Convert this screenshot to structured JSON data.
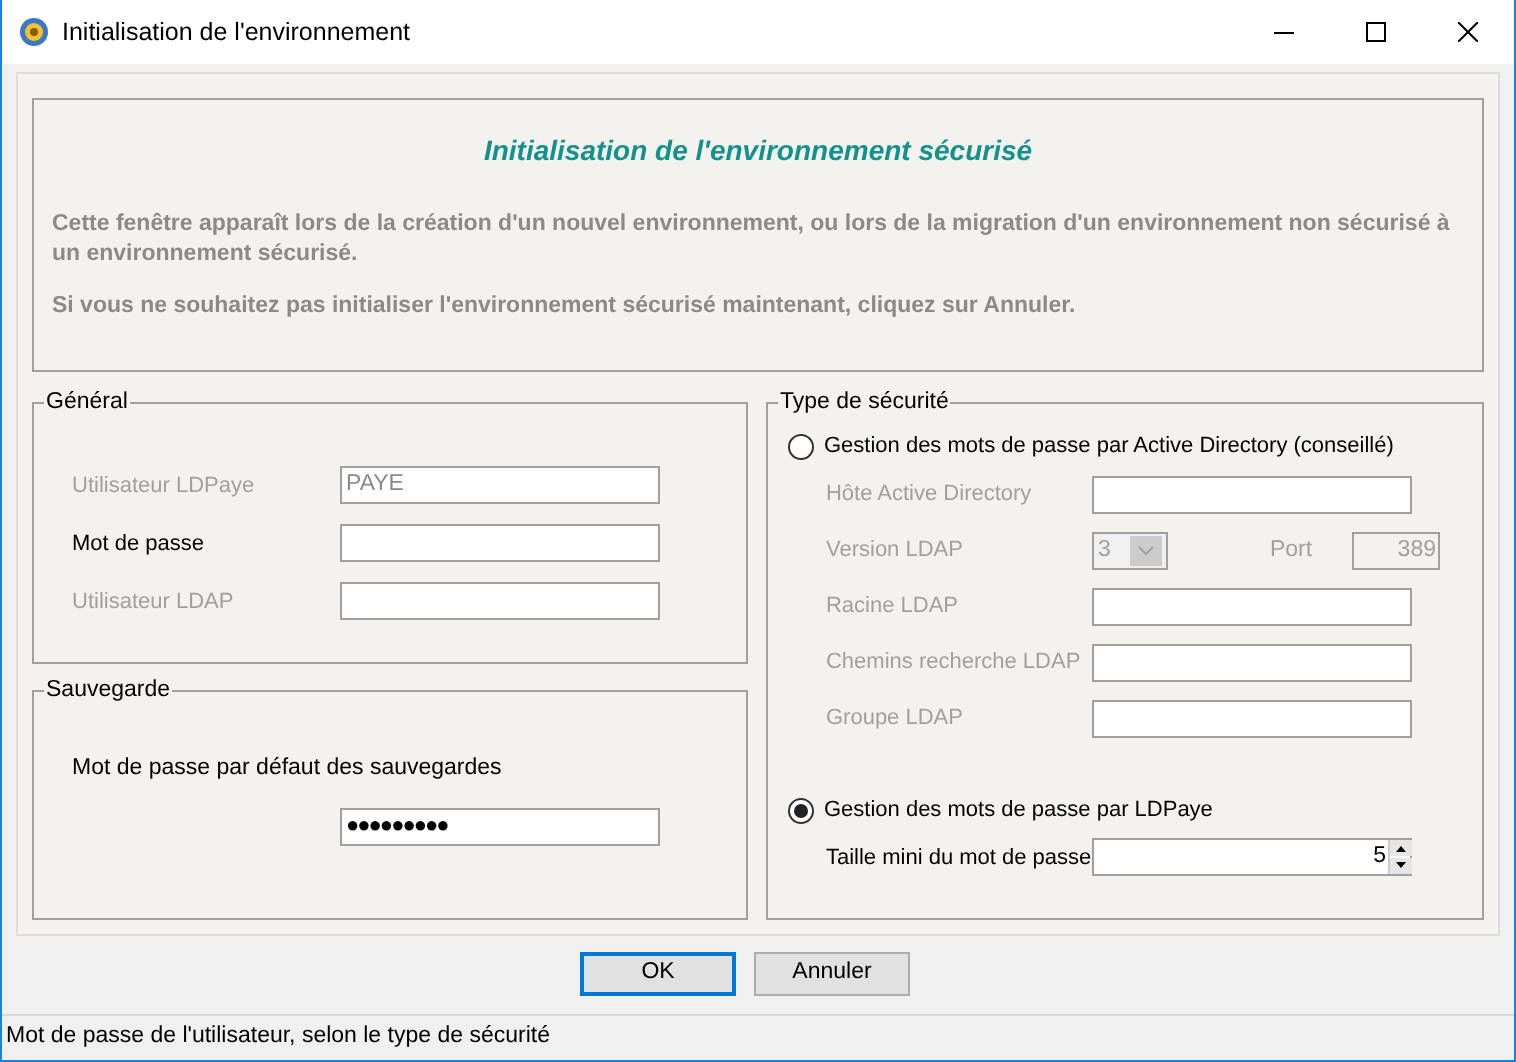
{
  "window": {
    "title": "Initialisation de l'environnement"
  },
  "header": {
    "title": "Initialisation de l'environnement sécurisé",
    "paragraphs": [
      "Cette fenêtre apparaît lors de la création d'un nouvel environnement, ou lors de la migration d'un environnement non sécurisé à un environnement sécurisé.",
      "Si vous ne souhaitez pas initialiser l'environnement sécurisé maintenant, cliquez sur Annuler."
    ]
  },
  "general": {
    "title": "Général",
    "fields": [
      {
        "label": "Utilisateur LDPaye",
        "value": "PAYE",
        "disabled": true
      },
      {
        "label": "Mot de passe",
        "disabled": false
      },
      {
        "label": "Utilisateur LDAP",
        "disabled": true
      }
    ]
  },
  "backup": {
    "title": "Sauvegarde",
    "label": "Mot de passe par défaut des sauvegardes",
    "value": "●●●●●●●●●"
  },
  "security": {
    "title": "Type de sécurité",
    "options": [
      {
        "label": "Gestion des mots de passe par Active Directory (conseillé)",
        "selected": false,
        "fields": [
          {
            "kind": "text",
            "label": "Hôte Active Directory",
            "disabled": true
          },
          {
            "kind": "version",
            "label": "Version LDAP",
            "value": "3",
            "port_label": "Port",
            "port_value": "389",
            "disabled": true
          },
          {
            "kind": "text",
            "label": "Racine LDAP",
            "disabled": true
          },
          {
            "kind": "text",
            "label": "Chemins recherche LDAP",
            "disabled": true
          },
          {
            "kind": "text",
            "label": "Groupe LDAP",
            "disabled": true
          }
        ]
      },
      {
        "label": "Gestion des mots de passe par LDPaye",
        "selected": true,
        "fields": [
          {
            "kind": "spinner",
            "label": "Taille mini du mot de passe",
            "value": "5",
            "disabled": false
          }
        ]
      }
    ]
  },
  "buttons": [
    {
      "label": "OK",
      "default": true
    },
    {
      "label": "Annuler",
      "default": false
    }
  ],
  "status_bar": "Mot de passe de l'utilisateur, selon le type de sécurité"
}
